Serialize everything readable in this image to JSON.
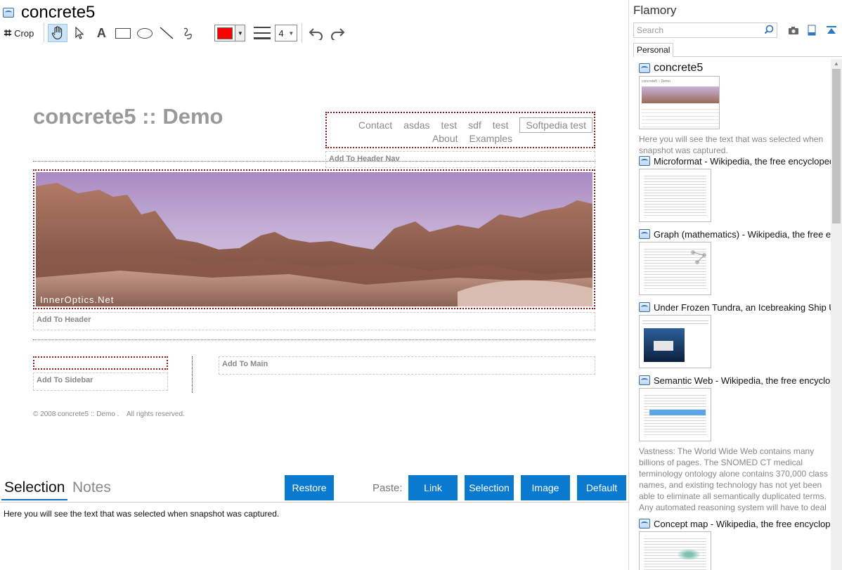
{
  "document": {
    "title": "concrete5"
  },
  "toolbar": {
    "crop_label": "Crop",
    "text_tool": "A",
    "line_width_value": "4",
    "active_color": "#ff0000"
  },
  "snapshot": {
    "site_title": "concrete5 :: Demo",
    "nav_row_1": [
      "Contact",
      "asdas",
      "test",
      "sdf",
      "test"
    ],
    "nav_button": "Softpedia test",
    "nav_row_2": [
      "About",
      "Examples"
    ],
    "add_header_nav": "Add To Header Nav",
    "banner_caption": "InnerOptics.Net",
    "add_header": "Add To Header",
    "add_sidebar": "Add To Sidebar",
    "add_main": "Add To Main",
    "footer": "© 2008 concrete5 :: Demo .    All rights reserved."
  },
  "bottom": {
    "tab_selection": "Selection",
    "tab_notes": "Notes",
    "restore": "Restore",
    "paste_label": "Paste:",
    "link": "Link",
    "selection": "Selection",
    "image": "Image",
    "default": "Default",
    "selection_text": "Here you will see the text that was selected when snapshot was captured."
  },
  "sidebar": {
    "app_name": "Flamory",
    "search_placeholder": "Search",
    "tab_personal": "Personal",
    "items": [
      {
        "title": "concrete5",
        "snippet": "Here you will see the text that was selected when snapshot was captured."
      },
      {
        "title": "Microformat - Wikipedia, the free encyclopedia",
        "snippet": ""
      },
      {
        "title": "Graph (mathematics) - Wikipedia, the free ency",
        "snippet": ""
      },
      {
        "title": "Under Frozen Tundra, an Icebreaking Ship Unco",
        "snippet": ""
      },
      {
        "title": "Semantic Web - Wikipedia, the free encycloped",
        "snippet": "Vastness: The World Wide Web contains many billions of pages. The SNOMED CT medical terminology ontology alone contains 370,000 class names, and existing technology has not yet been able to eliminate all semantically duplicated terms. Any automated reasoning system will have to deal with truly huge inputs."
      },
      {
        "title": "Concept map - Wikipedia, the free encyclopedia",
        "snippet": ""
      }
    ]
  }
}
